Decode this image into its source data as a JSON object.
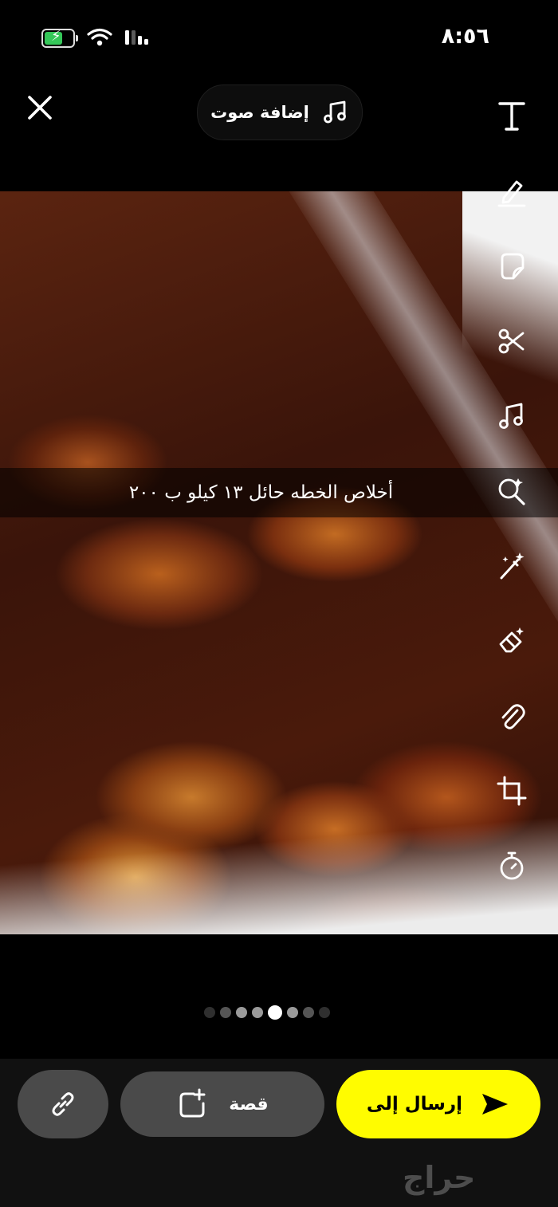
{
  "status_bar": {
    "time": "٨:٥٦",
    "battery_level": 0.7
  },
  "header": {
    "close_icon": "close-icon",
    "sound_label": "إضافة صوت",
    "sound_icon": "music-note-icon"
  },
  "tools": [
    {
      "name": "text-tool",
      "icon": "text-icon"
    },
    {
      "name": "draw-tool",
      "icon": "pencil-icon"
    },
    {
      "name": "sticker-tool",
      "icon": "sticker-icon"
    },
    {
      "name": "scissors-tool",
      "icon": "scissors-icon"
    },
    {
      "name": "music-tool",
      "icon": "music-note-icon"
    },
    {
      "name": "search-tool",
      "icon": "search-sparkle-icon"
    },
    {
      "name": "magic-wand-tool",
      "icon": "magic-wand-icon"
    },
    {
      "name": "eraser-tool",
      "icon": "eraser-icon"
    },
    {
      "name": "attachment-tool",
      "icon": "paperclip-icon"
    },
    {
      "name": "crop-tool",
      "icon": "crop-icon"
    },
    {
      "name": "timer-tool",
      "icon": "timer-icon"
    }
  ],
  "caption": {
    "text": "أخلاص الخطه حائل  ١٣ كيلو ب ٢٠٠"
  },
  "pagination": {
    "total": 8,
    "active_index": 4
  },
  "bottom": {
    "link_icon": "link-icon",
    "story_label": "قصة",
    "story_icon": "add-story-icon",
    "send_label": "إرسال إلى",
    "send_icon": "send-arrow-icon",
    "accent_color": "#fffc00"
  },
  "watermark": "حراج"
}
